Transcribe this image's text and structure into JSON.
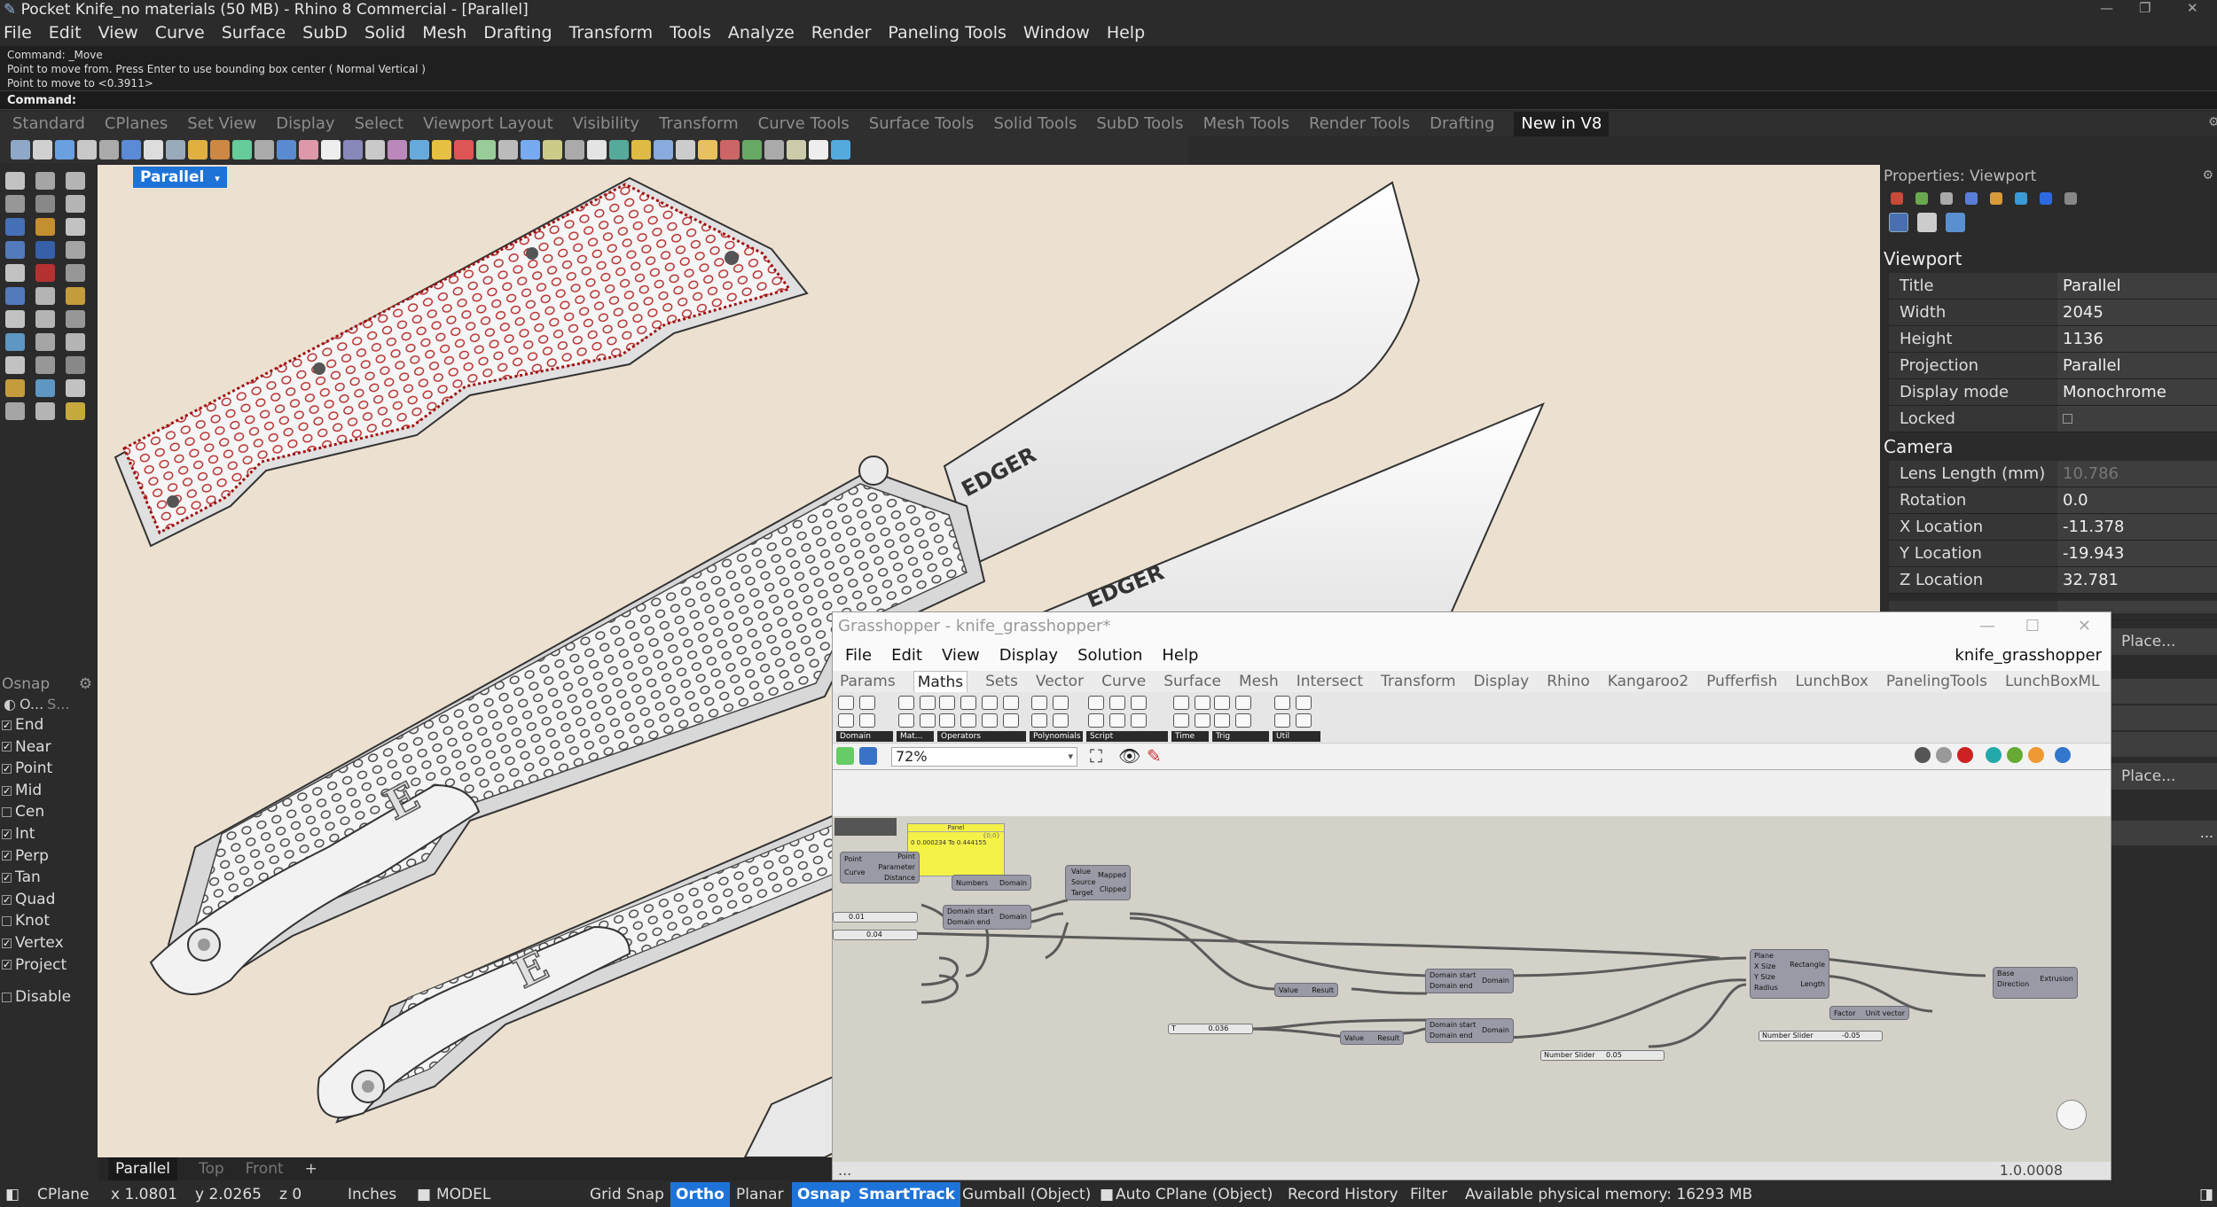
{
  "window": {
    "title": "Pocket Knife_no materials (50 MB) - Rhino 8 Commercial - [Parallel]"
  },
  "menu": [
    "File",
    "Edit",
    "View",
    "Curve",
    "Surface",
    "SubD",
    "Solid",
    "Mesh",
    "Drafting",
    "Transform",
    "Tools",
    "Analyze",
    "Render",
    "Paneling Tools",
    "Window",
    "Help"
  ],
  "command": {
    "history": [
      "Command: _Move",
      "Point to move from. Press Enter to use bounding box center ( Normal  Vertical )",
      "Point to move to <0.3911>"
    ],
    "prompt": "Command:"
  },
  "toolbar_tabs": [
    "Standard",
    "CPlanes",
    "Set View",
    "Display",
    "Select",
    "Viewport Layout",
    "Visibility",
    "Transform",
    "Curve Tools",
    "Surface Tools",
    "Solid Tools",
    "SubD Tools",
    "Mesh Tools",
    "Render Tools",
    "Drafting",
    "New in V8"
  ],
  "active_toolbar_tab": "New in V8",
  "viewport": {
    "label": "Parallel",
    "blade_text": "EDGER",
    "blade_text_2": "EDGER",
    "clip_letter": "E",
    "clip_letter_2": "E",
    "tabs": [
      "Parallel",
      "Top",
      "Front",
      "+"
    ]
  },
  "osnap": {
    "title": "Osnap",
    "subheader": "O...",
    "subheader2": "S...",
    "items": [
      {
        "label": "End",
        "checked": true
      },
      {
        "label": "Near",
        "checked": true
      },
      {
        "label": "Point",
        "checked": true
      },
      {
        "label": "Mid",
        "checked": true
      },
      {
        "label": "Cen",
        "checked": false
      },
      {
        "label": "Int",
        "checked": true
      },
      {
        "label": "Perp",
        "checked": true
      },
      {
        "label": "Tan",
        "checked": true
      },
      {
        "label": "Quad",
        "checked": true
      },
      {
        "label": "Knot",
        "checked": false
      },
      {
        "label": "Vertex",
        "checked": true
      },
      {
        "label": "Project",
        "checked": true
      }
    ],
    "disable": "Disable"
  },
  "properties": {
    "title": "Properties: Viewport",
    "viewport_section": "Viewport",
    "viewport_rows": [
      {
        "label": "Title",
        "value": "Parallel"
      },
      {
        "label": "Width",
        "value": "2045"
      },
      {
        "label": "Height",
        "value": "1136"
      },
      {
        "label": "Projection",
        "value": "Parallel"
      },
      {
        "label": "Display mode",
        "value": "Monochrome"
      },
      {
        "label": "Locked",
        "value": ""
      }
    ],
    "camera_section": "Camera",
    "camera_rows": [
      {
        "label": "Lens Length (mm)",
        "value": "10.786",
        "dim": true
      },
      {
        "label": "Rotation",
        "value": "0.0"
      },
      {
        "label": "X Location",
        "value": "-11.378"
      },
      {
        "label": "Y Location",
        "value": "-19.943"
      },
      {
        "label": "Z Location",
        "value": "32.781"
      }
    ],
    "place_label": "Place...",
    "place_label_2": "Place...",
    "more_label": "..."
  },
  "grasshopper": {
    "title": "Grasshopper - knife_grasshopper*",
    "doc_name": "knife_grasshopper",
    "menu": [
      "File",
      "Edit",
      "View",
      "Display",
      "Solution",
      "Help"
    ],
    "tabs": [
      "Params",
      "Maths",
      "Sets",
      "Vector",
      "Curve",
      "Surface",
      "Mesh",
      "Intersect",
      "Transform",
      "Display",
      "Rhino",
      "Kangaroo2",
      "Pufferfish",
      "LunchBox",
      "PanelingTools",
      "LunchBoxML"
    ],
    "active_tab": "Maths",
    "ribbon_groups": [
      "Domain",
      "Mat...",
      "Operators",
      "Polynomials",
      "Script",
      "Time",
      "Trig",
      "Util"
    ],
    "zoom": "72%",
    "version": "1.0.0008",
    "footer_dots": "...",
    "panel": {
      "title": "Panel",
      "subtitle": "{0;0}",
      "content": "0 0.000234 To 0.444155"
    },
    "components": {
      "curve_closest": {
        "inputs": [
          "Point",
          "Curve"
        ],
        "outputs": [
          "Point",
          "Parameter",
          "Distance"
        ]
      },
      "bounds": {
        "input": "Numbers",
        "output": "Domain"
      },
      "remap": {
        "inputs": [
          "Value",
          "Source",
          "Target"
        ],
        "outputs": [
          "Mapped",
          "Clipped"
        ]
      },
      "construct_domain_1": {
        "inputs": [
          "Domain start",
          "Domain end"
        ],
        "output": "Domain"
      },
      "construct_domain_2": {
        "inputs": [
          "Domain start",
          "Domain end"
        ],
        "output": "Domain"
      },
      "construct_domain_3": {
        "inputs": [
          "Domain start",
          "Domain end"
        ],
        "output": "Domain"
      },
      "negative_1": {
        "input": "Value",
        "output": "Result"
      },
      "negative_2": {
        "input": "Value",
        "output": "Result"
      },
      "rectangle": {
        "inputs": [
          "Plane",
          "X Size",
          "Y Size",
          "Radius"
        ],
        "outputs": [
          "Rectangle",
          "Length"
        ]
      },
      "unit_vector": {
        "input": "Factor",
        "output": "Unit vector"
      },
      "extrude": {
        "inputs": [
          "Base",
          "Direction"
        ],
        "output": "Extrusion"
      }
    },
    "sliders": {
      "s1": "0.01",
      "s2": "0.04",
      "s3": "0.036",
      "s4_label": "Number Slider",
      "s4": "0.05",
      "s5_label": "Number Slider",
      "s5": "-0.05",
      "s3_label": "T"
    }
  },
  "status": {
    "cplane": "CPlane",
    "x": "x 1.0801",
    "y": "y 2.0265",
    "z": "z 0",
    "units": "Inches",
    "layer": "MODEL",
    "grid_snap": "Grid Snap",
    "ortho": "Ortho",
    "planar": "Planar",
    "osnap": "Osnap",
    "smarttrack": "SmartTrack",
    "gumball": "Gumball (Object)",
    "autocplane": "Auto CPlane (Object)",
    "record": "Record History",
    "filter": "Filter",
    "memory": "Available physical memory: 16293 MB"
  },
  "colors": {
    "accent": "#1e73d8",
    "viewport_bg": "#ece1d0",
    "gh_canvas": "#d4d1c8",
    "panel_yellow": "#f4f148"
  }
}
